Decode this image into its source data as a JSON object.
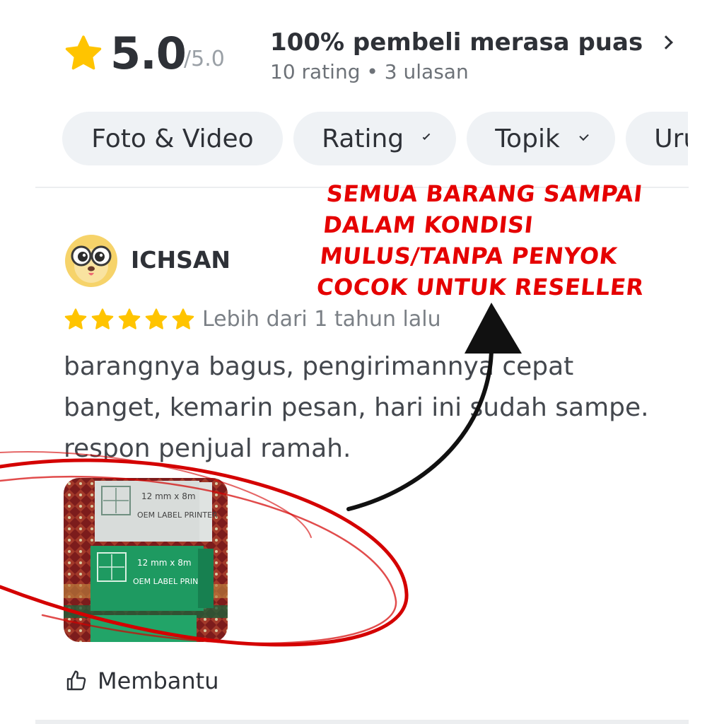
{
  "summary": {
    "score": "5.0",
    "score_max": "/5.0",
    "satisfaction": "100% pembeli merasa puas",
    "stats": "10 rating • 3 ulasan"
  },
  "filters": [
    {
      "label": "Foto & Video",
      "has_caret": false
    },
    {
      "label": "Rating",
      "has_caret": true
    },
    {
      "label": "Topik",
      "has_caret": true
    },
    {
      "label": "Uru",
      "has_caret": false
    }
  ],
  "review": {
    "reviewer_name": "ICHSAN",
    "rating": 5,
    "time": "Lebih dari 1 tahun lalu",
    "text": "barangnya bagus, pengirimannya cepat banget, kemarin pesan, hari ini sudah sampe. respon penjual ramah.",
    "helpful_label": "Membantu"
  },
  "annotation": {
    "lines": [
      "SEMUA BARANG SAMPAI",
      "DALAM KONDISI",
      "MULUS/TANPA PENYOK",
      "COCOK UNTUK RESELLER"
    ]
  },
  "photo_labels": {
    "product": "OEM LABEL PRINTER",
    "size": "12 mm x 8m"
  },
  "colors": {
    "star": "#ffc400",
    "annotation": "#e50000",
    "chip_bg": "#eff2f5",
    "text_primary": "#2e3137",
    "text_secondary": "#7b8086"
  },
  "icons": [
    "star-icon",
    "chevron-right-icon",
    "chevron-down-icon",
    "avatar-icon",
    "thumbs-up-icon"
  ]
}
